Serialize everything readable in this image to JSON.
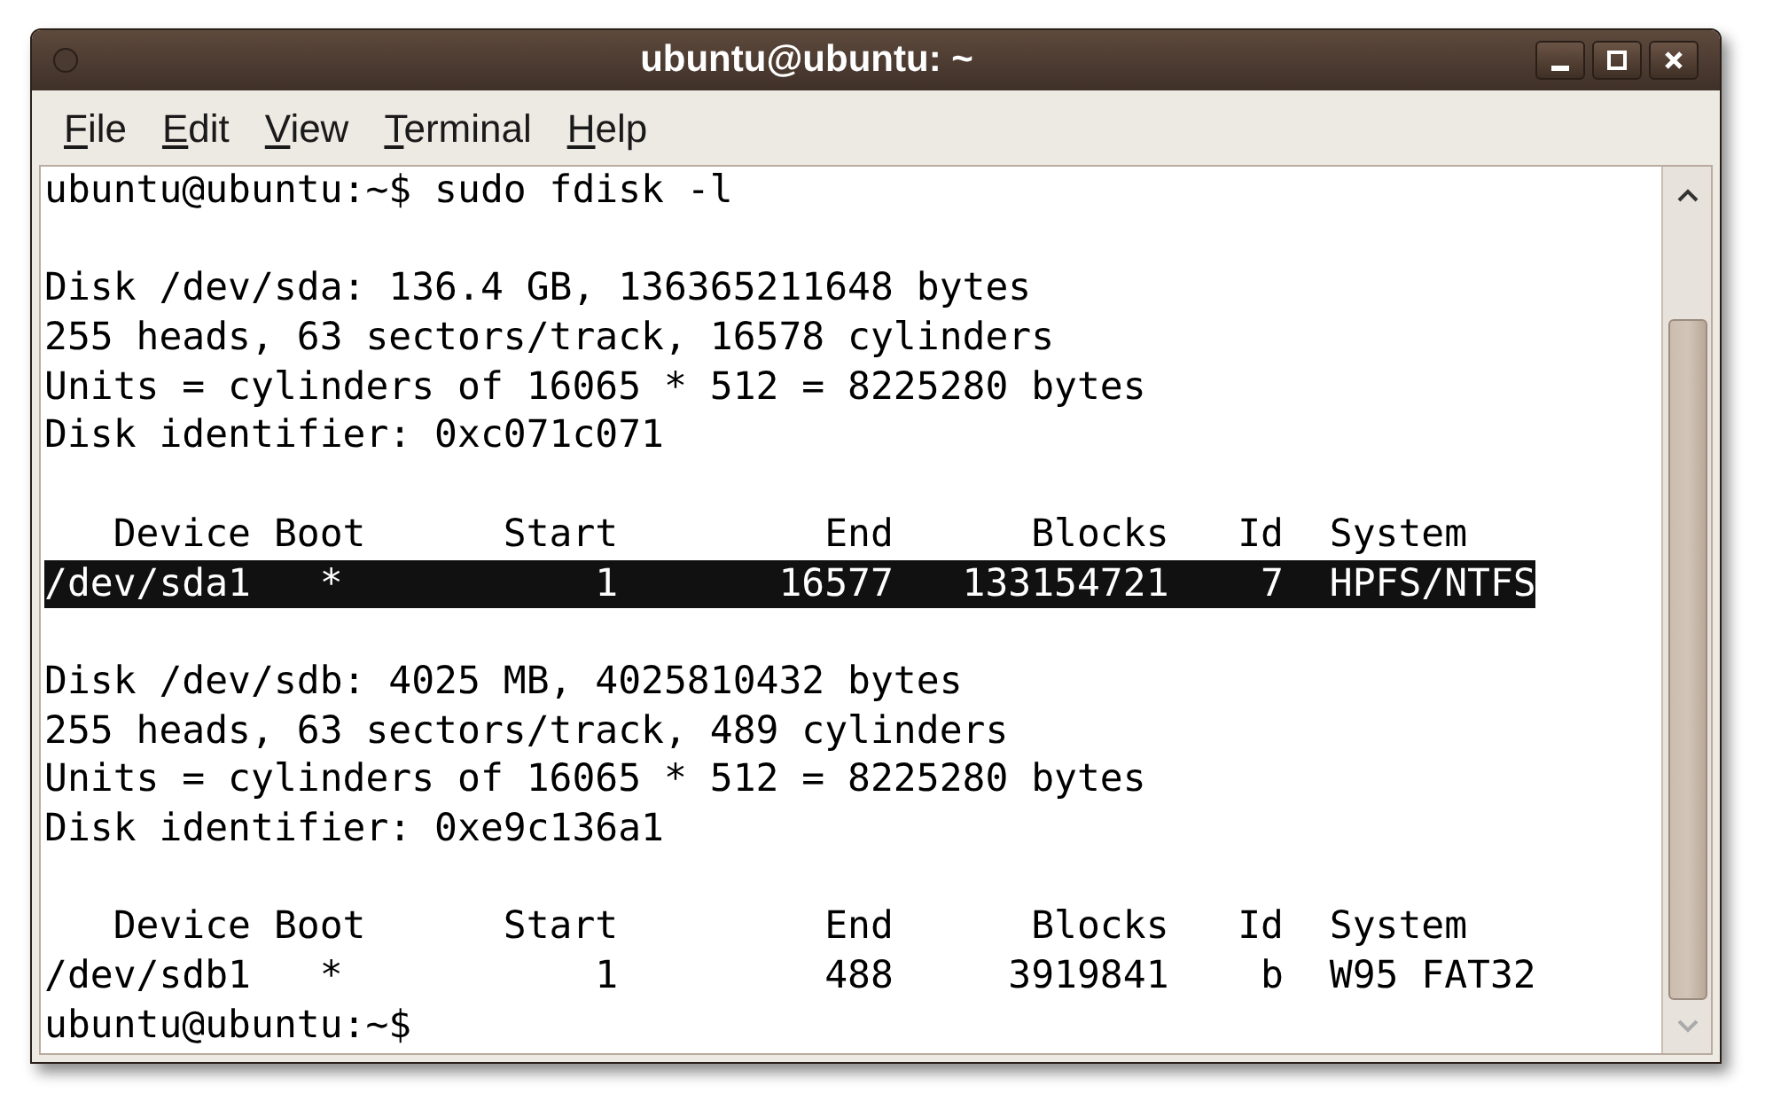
{
  "window": {
    "title": "ubuntu@ubuntu: ~"
  },
  "menu": [
    "File",
    "Edit",
    "View",
    "Terminal",
    "Help"
  ],
  "terminal": {
    "blocks": [
      {
        "lines": [
          {
            "text": "ubuntu@ubuntu:~$ sudo fdisk -l",
            "selected": false
          }
        ]
      },
      {
        "lines": [
          {
            "text": "Disk /dev/sda: 136.4 GB, 136365211648 bytes",
            "selected": false
          },
          {
            "text": "255 heads, 63 sectors/track, 16578 cylinders",
            "selected": false
          },
          {
            "text": "Units = cylinders of 16065 * 512 = 8225280 bytes",
            "selected": false
          },
          {
            "text": "Disk identifier: 0xc071c071",
            "selected": false
          }
        ]
      },
      {
        "lines": [
          {
            "text": "   Device Boot      Start         End      Blocks   Id  System",
            "selected": false
          },
          {
            "text": "/dev/sda1   *           1       16577   133154721    7  HPFS/NTFS",
            "selected": true
          }
        ]
      },
      {
        "lines": [
          {
            "text": "Disk /dev/sdb: 4025 MB, 4025810432 bytes",
            "selected": false
          },
          {
            "text": "255 heads, 63 sectors/track, 489 cylinders",
            "selected": false
          },
          {
            "text": "Units = cylinders of 16065 * 512 = 8225280 bytes",
            "selected": false
          },
          {
            "text": "Disk identifier: 0xe9c136a1",
            "selected": false
          }
        ]
      },
      {
        "lines": [
          {
            "text": "   Device Boot      Start         End      Blocks   Id  System",
            "selected": false
          },
          {
            "text": "/dev/sdb1   *           1         488     3919841    b  W95 FAT32",
            "selected": false
          },
          {
            "text": "ubuntu@ubuntu:~$",
            "selected": false
          }
        ]
      }
    ]
  }
}
